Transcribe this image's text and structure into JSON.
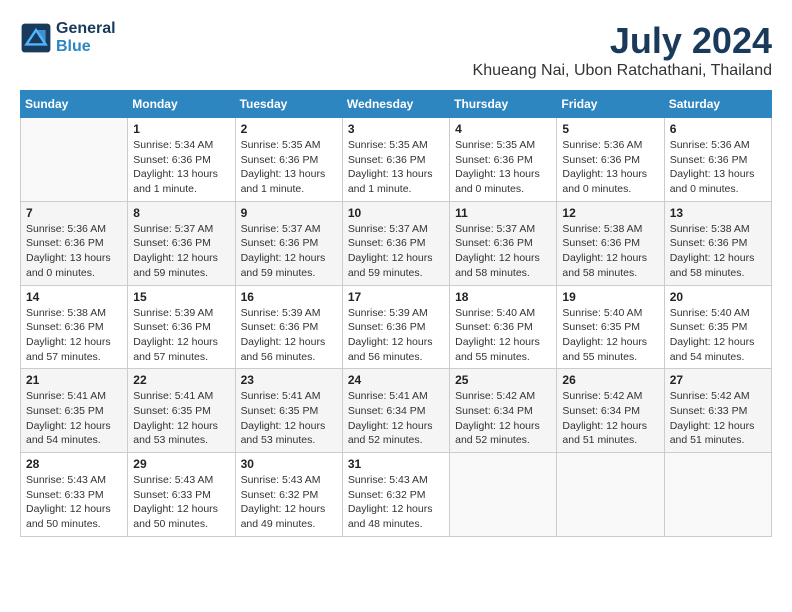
{
  "logo": {
    "line1": "General",
    "line2": "Blue"
  },
  "title": "July 2024",
  "location": "Khueang Nai, Ubon Ratchathani, Thailand",
  "days_of_week": [
    "Sunday",
    "Monday",
    "Tuesday",
    "Wednesday",
    "Thursday",
    "Friday",
    "Saturday"
  ],
  "weeks": [
    [
      {
        "num": "",
        "sunrise": "",
        "sunset": "",
        "daylight": "",
        "empty": true
      },
      {
        "num": "1",
        "sunrise": "Sunrise: 5:34 AM",
        "sunset": "Sunset: 6:36 PM",
        "daylight": "Daylight: 13 hours and 1 minute."
      },
      {
        "num": "2",
        "sunrise": "Sunrise: 5:35 AM",
        "sunset": "Sunset: 6:36 PM",
        "daylight": "Daylight: 13 hours and 1 minute."
      },
      {
        "num": "3",
        "sunrise": "Sunrise: 5:35 AM",
        "sunset": "Sunset: 6:36 PM",
        "daylight": "Daylight: 13 hours and 1 minute."
      },
      {
        "num": "4",
        "sunrise": "Sunrise: 5:35 AM",
        "sunset": "Sunset: 6:36 PM",
        "daylight": "Daylight: 13 hours and 0 minutes."
      },
      {
        "num": "5",
        "sunrise": "Sunrise: 5:36 AM",
        "sunset": "Sunset: 6:36 PM",
        "daylight": "Daylight: 13 hours and 0 minutes."
      },
      {
        "num": "6",
        "sunrise": "Sunrise: 5:36 AM",
        "sunset": "Sunset: 6:36 PM",
        "daylight": "Daylight: 13 hours and 0 minutes."
      }
    ],
    [
      {
        "num": "7",
        "sunrise": "Sunrise: 5:36 AM",
        "sunset": "Sunset: 6:36 PM",
        "daylight": "Daylight: 13 hours and 0 minutes."
      },
      {
        "num": "8",
        "sunrise": "Sunrise: 5:37 AM",
        "sunset": "Sunset: 6:36 PM",
        "daylight": "Daylight: 12 hours and 59 minutes."
      },
      {
        "num": "9",
        "sunrise": "Sunrise: 5:37 AM",
        "sunset": "Sunset: 6:36 PM",
        "daylight": "Daylight: 12 hours and 59 minutes."
      },
      {
        "num": "10",
        "sunrise": "Sunrise: 5:37 AM",
        "sunset": "Sunset: 6:36 PM",
        "daylight": "Daylight: 12 hours and 59 minutes."
      },
      {
        "num": "11",
        "sunrise": "Sunrise: 5:37 AM",
        "sunset": "Sunset: 6:36 PM",
        "daylight": "Daylight: 12 hours and 58 minutes."
      },
      {
        "num": "12",
        "sunrise": "Sunrise: 5:38 AM",
        "sunset": "Sunset: 6:36 PM",
        "daylight": "Daylight: 12 hours and 58 minutes."
      },
      {
        "num": "13",
        "sunrise": "Sunrise: 5:38 AM",
        "sunset": "Sunset: 6:36 PM",
        "daylight": "Daylight: 12 hours and 58 minutes."
      }
    ],
    [
      {
        "num": "14",
        "sunrise": "Sunrise: 5:38 AM",
        "sunset": "Sunset: 6:36 PM",
        "daylight": "Daylight: 12 hours and 57 minutes."
      },
      {
        "num": "15",
        "sunrise": "Sunrise: 5:39 AM",
        "sunset": "Sunset: 6:36 PM",
        "daylight": "Daylight: 12 hours and 57 minutes."
      },
      {
        "num": "16",
        "sunrise": "Sunrise: 5:39 AM",
        "sunset": "Sunset: 6:36 PM",
        "daylight": "Daylight: 12 hours and 56 minutes."
      },
      {
        "num": "17",
        "sunrise": "Sunrise: 5:39 AM",
        "sunset": "Sunset: 6:36 PM",
        "daylight": "Daylight: 12 hours and 56 minutes."
      },
      {
        "num": "18",
        "sunrise": "Sunrise: 5:40 AM",
        "sunset": "Sunset: 6:36 PM",
        "daylight": "Daylight: 12 hours and 55 minutes."
      },
      {
        "num": "19",
        "sunrise": "Sunrise: 5:40 AM",
        "sunset": "Sunset: 6:35 PM",
        "daylight": "Daylight: 12 hours and 55 minutes."
      },
      {
        "num": "20",
        "sunrise": "Sunrise: 5:40 AM",
        "sunset": "Sunset: 6:35 PM",
        "daylight": "Daylight: 12 hours and 54 minutes."
      }
    ],
    [
      {
        "num": "21",
        "sunrise": "Sunrise: 5:41 AM",
        "sunset": "Sunset: 6:35 PM",
        "daylight": "Daylight: 12 hours and 54 minutes."
      },
      {
        "num": "22",
        "sunrise": "Sunrise: 5:41 AM",
        "sunset": "Sunset: 6:35 PM",
        "daylight": "Daylight: 12 hours and 53 minutes."
      },
      {
        "num": "23",
        "sunrise": "Sunrise: 5:41 AM",
        "sunset": "Sunset: 6:35 PM",
        "daylight": "Daylight: 12 hours and 53 minutes."
      },
      {
        "num": "24",
        "sunrise": "Sunrise: 5:41 AM",
        "sunset": "Sunset: 6:34 PM",
        "daylight": "Daylight: 12 hours and 52 minutes."
      },
      {
        "num": "25",
        "sunrise": "Sunrise: 5:42 AM",
        "sunset": "Sunset: 6:34 PM",
        "daylight": "Daylight: 12 hours and 52 minutes."
      },
      {
        "num": "26",
        "sunrise": "Sunrise: 5:42 AM",
        "sunset": "Sunset: 6:34 PM",
        "daylight": "Daylight: 12 hours and 51 minutes."
      },
      {
        "num": "27",
        "sunrise": "Sunrise: 5:42 AM",
        "sunset": "Sunset: 6:33 PM",
        "daylight": "Daylight: 12 hours and 51 minutes."
      }
    ],
    [
      {
        "num": "28",
        "sunrise": "Sunrise: 5:43 AM",
        "sunset": "Sunset: 6:33 PM",
        "daylight": "Daylight: 12 hours and 50 minutes."
      },
      {
        "num": "29",
        "sunrise": "Sunrise: 5:43 AM",
        "sunset": "Sunset: 6:33 PM",
        "daylight": "Daylight: 12 hours and 50 minutes."
      },
      {
        "num": "30",
        "sunrise": "Sunrise: 5:43 AM",
        "sunset": "Sunset: 6:32 PM",
        "daylight": "Daylight: 12 hours and 49 minutes."
      },
      {
        "num": "31",
        "sunrise": "Sunrise: 5:43 AM",
        "sunset": "Sunset: 6:32 PM",
        "daylight": "Daylight: 12 hours and 48 minutes."
      },
      {
        "num": "",
        "sunrise": "",
        "sunset": "",
        "daylight": "",
        "empty": true
      },
      {
        "num": "",
        "sunrise": "",
        "sunset": "",
        "daylight": "",
        "empty": true
      },
      {
        "num": "",
        "sunrise": "",
        "sunset": "",
        "daylight": "",
        "empty": true
      }
    ]
  ]
}
